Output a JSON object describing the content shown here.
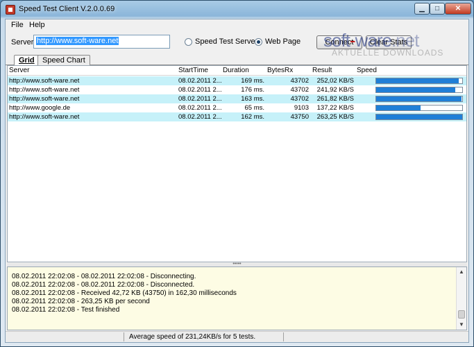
{
  "window": {
    "title": "Speed Test Client V.2.0.0.69"
  },
  "menu": {
    "items": [
      "File",
      "Help"
    ]
  },
  "toolbar": {
    "server_label": "Server",
    "server_value": "http://www.soft-ware.net",
    "radio_speed_server": "Speed Test Server",
    "radio_web_page": "Web Page",
    "selected_mode": "Web Page",
    "connect_label": "Connect",
    "clear_stats_label": "Clear Stats"
  },
  "watermark": {
    "brand_left": "soft",
    "brand_mid": "-",
    "brand_right": "ware",
    "brand_tld": ".net",
    "tagline": "AKTUELLE DOWNLOADS"
  },
  "tabs": [
    {
      "label": "Grid",
      "active": true
    },
    {
      "label": "Speed Chart",
      "active": false
    }
  ],
  "grid": {
    "columns": [
      "Server",
      "StartTime",
      "Duration",
      "BytesRx",
      "Result",
      "Speed"
    ],
    "rows": [
      {
        "server": "http://www.soft-ware.net",
        "start": "08.02.2011 2...",
        "duration": "169 ms.",
        "bytes": "43702",
        "result": "252,02 KB/S",
        "speed": 0.96
      },
      {
        "server": "http://www.soft-ware.net",
        "start": "08.02.2011 2...",
        "duration": "176 ms.",
        "bytes": "43702",
        "result": "241,92 KB/S",
        "speed": 0.92
      },
      {
        "server": "http://www.soft-ware.net",
        "start": "08.02.2011 2...",
        "duration": "163 ms.",
        "bytes": "43702",
        "result": "261,82 KB/S",
        "speed": 0.995
      },
      {
        "server": "http://www.google.de",
        "start": "08.02.2011 2...",
        "duration": "65 ms.",
        "bytes": "9103",
        "result": "137,22 KB/S",
        "speed": 0.52
      },
      {
        "server": "http://www.soft-ware.net",
        "start": "08.02.2011 2...",
        "duration": "162 ms.",
        "bytes": "43750",
        "result": "263,25 KB/S",
        "speed": 1.0
      }
    ]
  },
  "log": [
    "08.02.2011 22:02:08 - 08.02.2011 22:02:08 - Disconnecting.",
    "08.02.2011 22:02:08 - 08.02.2011 22:02:08 - Disconnected.",
    "08.02.2011 22:02:08 - Received 42,72 KB (43750) in 162,30 milliseconds",
    "08.02.2011 22:02:08 - 263,25 KB per second",
    "08.02.2011 22:02:08 - Test finished"
  ],
  "status": {
    "text": "Average speed of 231,24KB/s for 5 tests."
  },
  "colors": {
    "bar_fill": "#1f7fd7",
    "row_alt": "#c6f1f9",
    "log_bg": "#fdfce4"
  }
}
